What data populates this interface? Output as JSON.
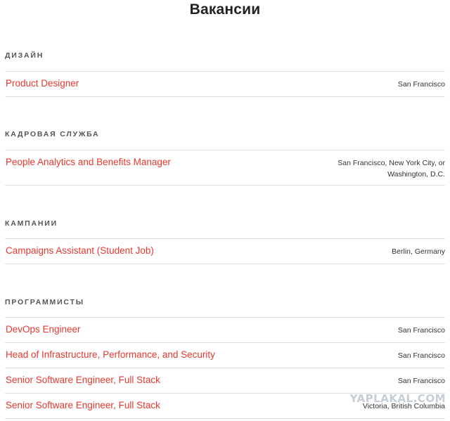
{
  "page": {
    "title": "Вакансии"
  },
  "sections": [
    {
      "heading": "ДИЗАЙН",
      "jobs": [
        {
          "title": "Product Designer",
          "location": [
            "San Francisco"
          ]
        }
      ]
    },
    {
      "heading": "КАДРОВАЯ СЛУЖБА",
      "jobs": [
        {
          "title": "People Analytics and Benefits Manager",
          "location": [
            "San Francisco, New York City, or",
            "Washington, D.C."
          ]
        }
      ]
    },
    {
      "heading": "КАМПАНИИ",
      "jobs": [
        {
          "title": "Campaigns Assistant (Student Job)",
          "location": [
            "Berlin, Germany"
          ]
        }
      ]
    },
    {
      "heading": "ПРОГРАММИСТЫ",
      "jobs": [
        {
          "title": "DevOps Engineer",
          "location": [
            "San Francisco"
          ]
        },
        {
          "title": "Head of Infrastructure, Performance, and Security",
          "location": [
            "San Francisco"
          ]
        },
        {
          "title": "Senior Software Engineer, Full Stack",
          "location": [
            "San Francisco"
          ]
        },
        {
          "title": "Senior Software Engineer, Full Stack",
          "location": [
            "Victoria, British Columbia"
          ]
        }
      ]
    }
  ],
  "watermark": "YAPLAKAL.COM",
  "colors": {
    "link": "#e8382f",
    "heading": "#555555",
    "divider": "#dedede"
  }
}
